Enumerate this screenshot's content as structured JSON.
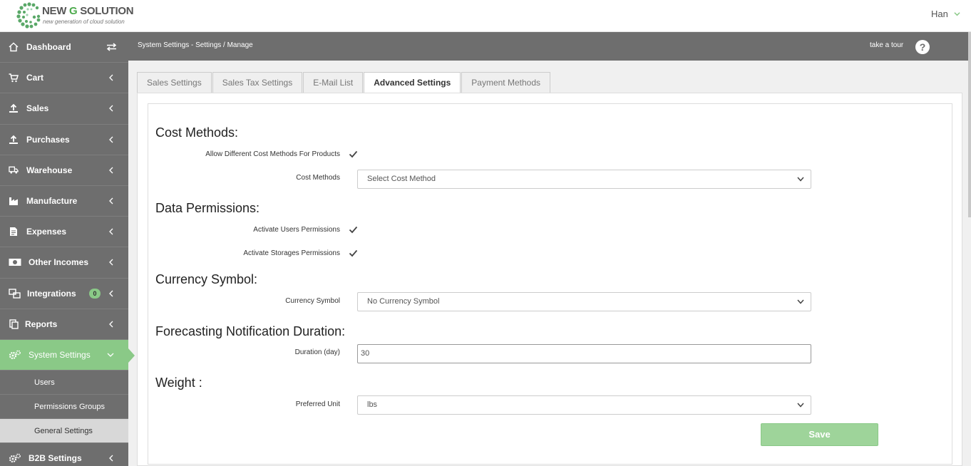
{
  "header": {
    "logo_title_a": "NEW ",
    "logo_title_b": "G",
    "logo_title_c": " SOLUTION",
    "logo_sub": "new generation of cloud solution",
    "user": "Han"
  },
  "sidebar": {
    "items": [
      {
        "label": "Dashboard"
      },
      {
        "label": "Cart"
      },
      {
        "label": "Sales"
      },
      {
        "label": "Purchases"
      },
      {
        "label": "Warehouse"
      },
      {
        "label": "Manufacture"
      },
      {
        "label": "Expenses"
      },
      {
        "label": "Other Incomes"
      },
      {
        "label": "Integrations",
        "badge": "0"
      },
      {
        "label": "Reports"
      },
      {
        "label": "System Settings"
      }
    ],
    "sub_items": [
      {
        "label": "Users"
      },
      {
        "label": "Permissions Groups"
      },
      {
        "label": "General Settings"
      }
    ],
    "after": {
      "label": "B2B Settings"
    }
  },
  "breadcrumb": {
    "path": "System Settings - Settings /  Manage",
    "tour": "take a tour",
    "help": "?"
  },
  "tabs": [
    {
      "label": "Sales Settings"
    },
    {
      "label": "Sales Tax Settings"
    },
    {
      "label": "E-Mail List"
    },
    {
      "label": "Advanced Settings"
    },
    {
      "label": "Payment Methods"
    }
  ],
  "form": {
    "cost_methods_title": "Cost Methods:",
    "allow_diff_label": "Allow Different Cost Methods For Products",
    "cost_methods_label": "Cost Methods",
    "cost_methods_value": "Select Cost Method",
    "data_perm_title": "Data Permissions:",
    "users_perm_label": "Activate Users Permissions",
    "storages_perm_label": "Activate Storages Permissions",
    "currency_title": "Currency Symbol:",
    "currency_label": "Currency Symbol",
    "currency_value": "No Currency Symbol",
    "forecast_title": "Forecasting Notification Duration:",
    "duration_label": "Duration (day)",
    "duration_value": "30",
    "weight_title": "Weight :",
    "unit_label": "Preferred Unit",
    "unit_value": "lbs",
    "save_label": "Save"
  },
  "colors": {
    "sidebar_bg": "#6e6e6e",
    "accent_green": "#8ac987",
    "save_green": "#9ed49a"
  }
}
